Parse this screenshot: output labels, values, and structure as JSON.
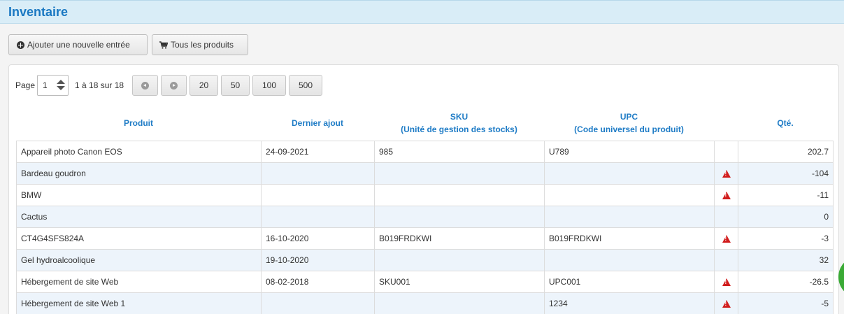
{
  "header": {
    "title": "Inventaire"
  },
  "actions": {
    "add_label": "Ajouter une nouvelle entrée",
    "all_products_label": "Tous les produits"
  },
  "pager": {
    "page_label": "Page",
    "page_value": "1",
    "range_text": "1 à 18 sur 18",
    "sizes": [
      "20",
      "50",
      "100",
      "500"
    ]
  },
  "table": {
    "headers": {
      "product": "Produit",
      "last_added": "Dernier ajout",
      "sku_1": "SKU",
      "sku_2": "(Unité de gestion des stocks)",
      "upc_1": "UPC",
      "upc_2": "(Code universel du produit)",
      "qty": "Qté."
    },
    "rows": [
      {
        "product": "Appareil photo Canon EOS",
        "date": "24-09-2021",
        "sku": "985",
        "upc": "U789",
        "warn": false,
        "qty": "202.7"
      },
      {
        "product": "Bardeau goudron",
        "date": "",
        "sku": "",
        "upc": "",
        "warn": true,
        "qty": "-104"
      },
      {
        "product": "BMW",
        "date": "",
        "sku": "",
        "upc": "",
        "warn": true,
        "qty": "-11"
      },
      {
        "product": "Cactus",
        "date": "",
        "sku": "",
        "upc": "",
        "warn": false,
        "qty": "0"
      },
      {
        "product": "CT4G4SFS824A",
        "date": "16-10-2020",
        "sku": "B019FRDKWI",
        "upc": "B019FRDKWI",
        "warn": true,
        "qty": "-3"
      },
      {
        "product": "Gel hydroalcoolique",
        "date": "19-10-2020",
        "sku": "",
        "upc": "",
        "warn": false,
        "qty": "32"
      },
      {
        "product": "Hébergement de site Web",
        "date": "08-02-2018",
        "sku": "SKU001",
        "upc": "UPC001",
        "warn": true,
        "qty": "-26.5"
      },
      {
        "product": "Hébergement de site Web 1",
        "date": "",
        "sku": "",
        "upc": "1234",
        "warn": true,
        "qty": "-5"
      }
    ]
  },
  "colors": {
    "header_bg": "#d9edf7",
    "accent": "#1f7cc6",
    "warning": "#d11d1d",
    "row_alt": "#edf4fb"
  },
  "icons": {
    "add": "plus-circle-icon",
    "cart": "cart-icon",
    "prev": "arrow-left-circle-icon",
    "next": "arrow-right-circle-icon",
    "warning": "warning-triangle-icon"
  }
}
